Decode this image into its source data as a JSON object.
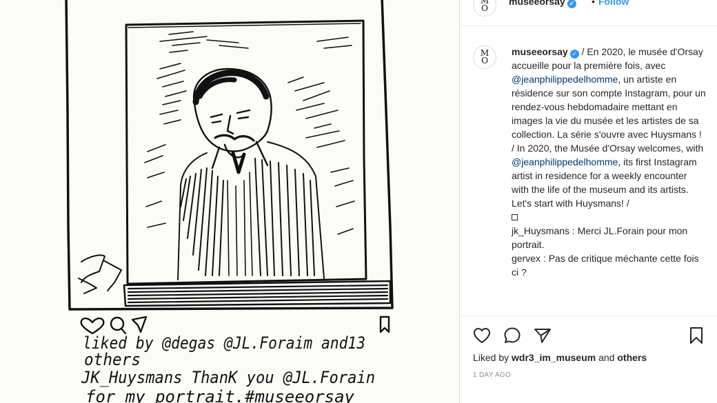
{
  "post": {
    "username": "museeorsay",
    "follow_label": "Follow",
    "header_separator": "•",
    "avatar_letters": "M\nO",
    "verified_glyph": "✓"
  },
  "caption": {
    "username": "museeorsay",
    "text_1": " / En 2020, le musée d'Orsay accueille pour la première fois, avec ",
    "mention_1": "@jeanphilippedelhomme",
    "text_2": ", un artiste en résidence sur son compte Instagram, pour un rendez-vous hebdomadaire mettant en images la vie du musée et les artistes de sa collection. La série s'ouvre avec Huysmans ! / In 2020, the Musée d'Orsay welcomes, with ",
    "mention_2": "@jeanphilippedelhomme",
    "text_3": ", its first Instagram artist in residence for a weekly encounter with the life of the museum and its artists. Let's start with Huysmans! /",
    "comment_1": "jk_Huysmans : Merci JL.Forain pour mon portrait.",
    "comment_2": "gervex : Pas de critique méchante cette fois ci ?"
  },
  "actions": {
    "like_icon": "heart-outline-icon",
    "comment_icon": "comment-bubble-icon",
    "share_icon": "paper-plane-icon",
    "save_icon": "bookmark-icon",
    "liked_by_prefix": "Liked by ",
    "liked_by_user": "wdr3_im_museum",
    "liked_by_and": " and ",
    "liked_by_others": "others",
    "date": "1 DAY AGO"
  },
  "drawing": {
    "line_1": "liked by @degas @JL.Foraim and13",
    "line_2": "others",
    "line_3": "JK_Huysmans ThanK you @JL.Forain",
    "line_4": "for my portrait.#museeorsay"
  },
  "colors": {
    "accent": "#3897f0",
    "mention": "#00376b",
    "muted": "#8e8e8e",
    "ink": "#111111"
  }
}
